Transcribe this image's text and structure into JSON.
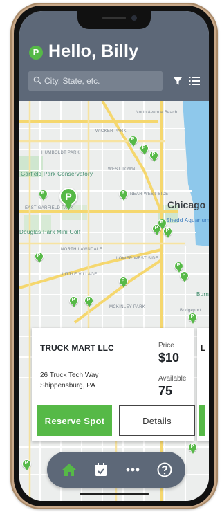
{
  "header": {
    "greeting": "Hello, Billy",
    "search": {
      "placeholder": "City, State, etc.",
      "value": ""
    },
    "icons": {
      "logo": "parking-logo-icon",
      "search": "search-icon",
      "filter": "filter-icon",
      "list": "list-view-icon"
    }
  },
  "map": {
    "labels": {
      "north_avenue_beach": "North Avenue Beach",
      "wicker_park": "WICKER PARK",
      "humboldt_park": "HUMBOLDT PARK",
      "west_town": "WEST TOWN",
      "garfield_park_conservatory": "Garfield Park Conservatory",
      "east_garfield_park": "EAST GARFIELD PARK",
      "near_west_side": "NEAR WEST SIDE",
      "chicago": "Chicago",
      "shedd_aquarium": "Shedd Aquarium",
      "douglas_park": "Douglas Park Mini Golf",
      "north_lawndale": "NORTH LAWNDALE",
      "lower_west_side": "LOWER WEST SIDE",
      "little_village": "LITTLE VILLAGE",
      "mckinley_park": "MCKINLEY PARK",
      "bridgeport": "Bridgeport",
      "burn": "Burn"
    }
  },
  "card": {
    "title": "TRUCK MART LLC",
    "address_line1": "26 Truck Tech Way",
    "address_line2": "Shippensburg, PA",
    "price_label": "Price",
    "price_value": "$10",
    "available_label": "Available",
    "available_value": "75",
    "reserve_label": "Reserve Spot",
    "details_label": "Details",
    "peek_letter": "L"
  },
  "nav": {
    "items": [
      "home-icon",
      "calendar-check-icon",
      "more-icon",
      "help-icon"
    ],
    "active": "home-icon"
  },
  "colors": {
    "brand_green": "#56b947",
    "header_slate": "#5d6878",
    "map_bg": "#eceeed",
    "water": "#8ec8eb"
  }
}
